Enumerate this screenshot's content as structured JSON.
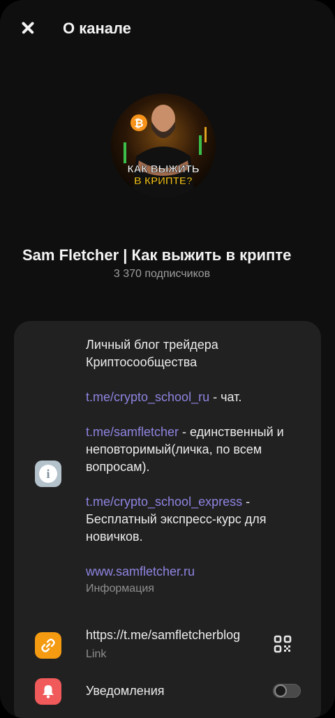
{
  "header": {
    "title": "О канале"
  },
  "channel": {
    "name": "Sam Fletcher | Как выжить в крипте",
    "subscribers": "3 370 подписчиков",
    "avatar_text_line1": "КАК ВЫЖИТЬ",
    "avatar_text_line2": "В КРИПТЕ?"
  },
  "info": {
    "line1": "Личный блог трейдера",
    "line2": "Криптосообщества",
    "link1": "t.me/crypto_school_ru",
    "link1_suffix": " - чат.",
    "link2": "t.me/samfletcher",
    "link2_suffix": " - единственный и неповторимый(личка, по всем вопросам).",
    "link3": "t.me/crypto_school_express",
    "link3_suffix": " - Бесплатный экспресс-курс для новичков.",
    "website": "www.samfletcher.ru",
    "caption": "Информация"
  },
  "link_row": {
    "url": "https://t.me/samfletcherblog",
    "caption": "Link"
  },
  "notifications": {
    "label": "Уведомления",
    "enabled": false
  },
  "colors": {
    "link": "#8d84e0",
    "card": "#212121",
    "link_icon": "#f49b12",
    "bell_icon": "#f05a5a",
    "info_icon": "#b4c2cc"
  }
}
